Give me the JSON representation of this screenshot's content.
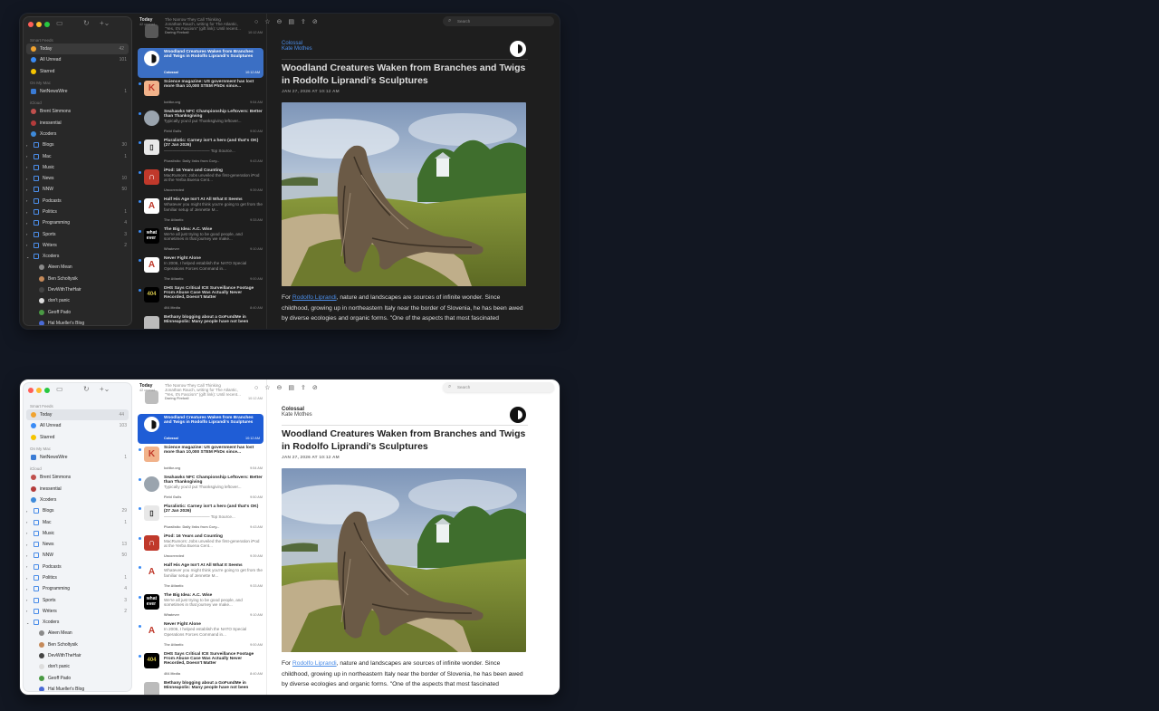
{
  "sidebar": {
    "smart_feeds_label": "Smart Feeds",
    "smart_feeds": [
      {
        "label": "Today",
        "dark_count": "42",
        "light_count": "44",
        "icon": "sun-icon",
        "color": "#f0a330"
      },
      {
        "label": "All Unread",
        "dark_count": "101",
        "light_count": "103",
        "icon": "unread-icon",
        "color": "#3a8bf5"
      },
      {
        "label": "Starred",
        "dark_count": "",
        "light_count": "",
        "icon": "star-icon",
        "color": "#f5c400"
      }
    ],
    "on_my_mac_label": "On My Mac",
    "on_my_mac": [
      {
        "label": "NetNewsWire",
        "count": "1"
      }
    ],
    "icloud_label": "iCloud",
    "icloud_feeds": [
      {
        "label": "Brent Simmons"
      },
      {
        "label": "inessential"
      },
      {
        "label": "Xcoders"
      }
    ],
    "folders": [
      {
        "label": "Blogs",
        "dark_count": "30",
        "light_count": "29"
      },
      {
        "label": "Mac",
        "dark_count": "1",
        "light_count": "1"
      },
      {
        "label": "Music",
        "dark_count": "",
        "light_count": ""
      },
      {
        "label": "News",
        "dark_count": "10",
        "light_count": "13"
      },
      {
        "label": "NNW",
        "dark_count": "50",
        "light_count": "50"
      },
      {
        "label": "Podcasts",
        "dark_count": "",
        "light_count": ""
      },
      {
        "label": "Politics",
        "dark_count": "1",
        "light_count": "1"
      },
      {
        "label": "Programming",
        "dark_count": "4",
        "light_count": "4"
      },
      {
        "label": "Sports",
        "dark_count": "3",
        "light_count": "3"
      },
      {
        "label": "Writers",
        "dark_count": "2",
        "light_count": "2"
      },
      {
        "label": "Xcoders",
        "dark_count": "",
        "light_count": ""
      }
    ],
    "xcoders_feeds": [
      {
        "label": "Aleen Mean"
      },
      {
        "label": "Ben Scholtysik"
      },
      {
        "label": "DevWithTheHair"
      },
      {
        "label": "don't panic"
      },
      {
        "label": "Geoff Pado"
      },
      {
        "label": "Hal Mueller's Blog"
      }
    ]
  },
  "timeline": {
    "title": "Today",
    "subtitle": "42 unread",
    "ghost": {
      "title": "The Narrow They Call Thinking",
      "line1": "Jonathan Rauch, writing for The Atlantic,",
      "line2": "\"Yes, It's Fascism\" (gift link): Until recent...",
      "source": "Daring Fireball",
      "time": "10:12 AM"
    },
    "articles": [
      {
        "title": "Woodland Creatures Waken from Branches and Twigs in Rodolfo Liprandi's Sculptures",
        "snippet": "",
        "source": "Colossal",
        "time": "10:12 AM",
        "selected": true,
        "unread": false,
        "avatar": "colossal-logo-icon"
      },
      {
        "title": "Science magazine: US government has lost more than 10,000 STEM PhDs since...",
        "snippet": "",
        "source": "kottke.org",
        "time": "9:54 AM",
        "selected": false,
        "unread": true,
        "avatar": "K"
      },
      {
        "title": "Seahawks NFC Championship Leftovers: Better than Thanksgiving",
        "snippet": "Typically you'd put Thanksgiving leftover...",
        "source": "Field Gulls",
        "time": "9:50 AM",
        "selected": false,
        "unread": true,
        "avatar": "seahawks-logo-icon"
      },
      {
        "title": "Pluralistic: Carney isn't a hero (and that's OK) (27 Jan 2026)",
        "snippet": "——————————— Top Source...",
        "source": "Pluralistic: Daily links from Cory...",
        "time": "9:43 AM",
        "selected": false,
        "unread": true,
        "avatar": "pluralistic-logo-icon"
      },
      {
        "title": "iPod: 16 Years and Counting",
        "snippet": "MacRumors: Jobs unveiled the first-generation iPod at the Yerba Buena Cent...",
        "source": "Uncorrected",
        "time": "9:39 AM",
        "selected": false,
        "unread": true,
        "avatar": "uncorrected-logo-icon"
      },
      {
        "title": "Half His Age Isn't At All What It Seems",
        "snippet": "Whatever you might think you're going to get from the familiar setup of Jennette M...",
        "source": "The Atlantic",
        "time": "9:33 AM",
        "selected": false,
        "unread": true,
        "avatar": "A"
      },
      {
        "title": "The Big Idea: A.C. Wise",
        "snippet": "We're all just trying to be good people, and sometimes in that journey we make...",
        "source": "Whatever",
        "time": "9:10 AM",
        "selected": false,
        "unread": true,
        "avatar": "whatever"
      },
      {
        "title": "Never Fight Alone",
        "snippet": "In 2006, I helped establish the NATO Special Operations Forces Command in...",
        "source": "The Atlantic",
        "time": "9:00 AM",
        "selected": false,
        "unread": true,
        "avatar": "A"
      },
      {
        "title": "DHS Says Critical ICE Surveillance Footage From Abuse Case Was Actually Never Recorded, Doesn't Matter",
        "snippet": "",
        "source": "404 Media",
        "time": "8:40 AM",
        "selected": false,
        "unread": true,
        "avatar": "404"
      },
      {
        "title": "Bethany blogging about a GoFundMe in Minneapolis: Many people have not been",
        "snippet": "",
        "source": "",
        "time": "",
        "selected": false,
        "unread": false,
        "avatar": "bethany-avatar-icon"
      }
    ]
  },
  "toolbar": {
    "search_placeholder": "Search"
  },
  "reader": {
    "source": "Colossal",
    "author": "Kate Mothes",
    "headline": "Woodland Creatures Waken from Branches and Twigs in Rodolfo Liprandi's Sculptures",
    "date": "JAN 27, 2026 AT 10:12 AM",
    "body_prefix": "For ",
    "body_link": "Rodolfo Liprandi",
    "body_rest": ", nature and landscapes are sources of infinite wonder. Since childhood, growing up in northeastern Italy near the border of Slovenia, he has been awed by diverse ecologies and organic forms. \"One of the aspects that most fascinated"
  },
  "colors": {
    "accent": "#3a8bf5",
    "selection_dark": "#3b6fc4",
    "selection_light": "#1f5dd6",
    "traffic_close": "#ff5f57",
    "traffic_min": "#febc2e",
    "traffic_max": "#28c840"
  }
}
